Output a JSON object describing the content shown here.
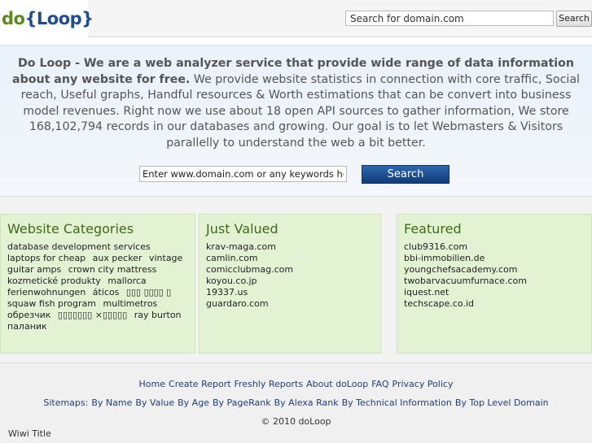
{
  "logo": {
    "part1": "do",
    "part2": "{Loop}"
  },
  "top_search": {
    "placeholder": "Search for domain.com",
    "button": "Search"
  },
  "hero": {
    "bold": "Do Loop - We are a web analyzer service that provide wide range of data information about any website for free.",
    "text": " We provide website statistics in connection with core traffic, Social reach, Useful graphs, Handful resources & Worth estimations that can be convert into business model revenues. Right now we use about 18 open API sources to gather information, We store 168,102,794 records in our databases and growing. Our goal is to let Webmasters & Visitors parallelly to understand the web a bit better.",
    "input_value": "Enter www.domain.com or any keywords here!",
    "search_button": "Search"
  },
  "categories": {
    "title": "Website Categories",
    "items": [
      "database development services",
      "laptops for cheap",
      "aux pecker",
      "vintage guitar amps",
      "crown city mattress",
      "kozmetické produkty",
      "mallorca ferienwohnungen",
      "áticos",
      "▯▯▯ ▯▯▯▯ ▯",
      "squaw fish program",
      "multimetros",
      "обрезчик",
      "▯▯▯▯▯▯▯ ×▯▯▯▯▯",
      "ray burton",
      "паланик"
    ]
  },
  "just_valued": {
    "title": "Just Valued",
    "items": [
      "krav-maga.com",
      "camlin.com",
      "comicclubmag.com",
      "koyou.co.jp",
      "19337.us",
      "guardaro.com"
    ]
  },
  "featured": {
    "title": "Featured",
    "items": [
      "club9316.com",
      "bbi-immobilien.de",
      "youngchefsacademy.com",
      "twobarvacuumfurnace.com",
      "iquest.net",
      "techscape.co.id"
    ]
  },
  "footer": {
    "links": [
      "Home",
      "Create Report",
      "Freshly Reports",
      "About doLoop",
      "FAQ",
      "Privacy Policy"
    ],
    "sitemaps_label": "Sitemaps:",
    "sitemaps": [
      "By Name",
      "By Value",
      "By Age",
      "By PageRank",
      "By Alexa Rank",
      "By Technical Information",
      "By Top Level Domain"
    ],
    "copyright": "© 2010 doLoop",
    "wiwi": "Wiwi Title"
  }
}
